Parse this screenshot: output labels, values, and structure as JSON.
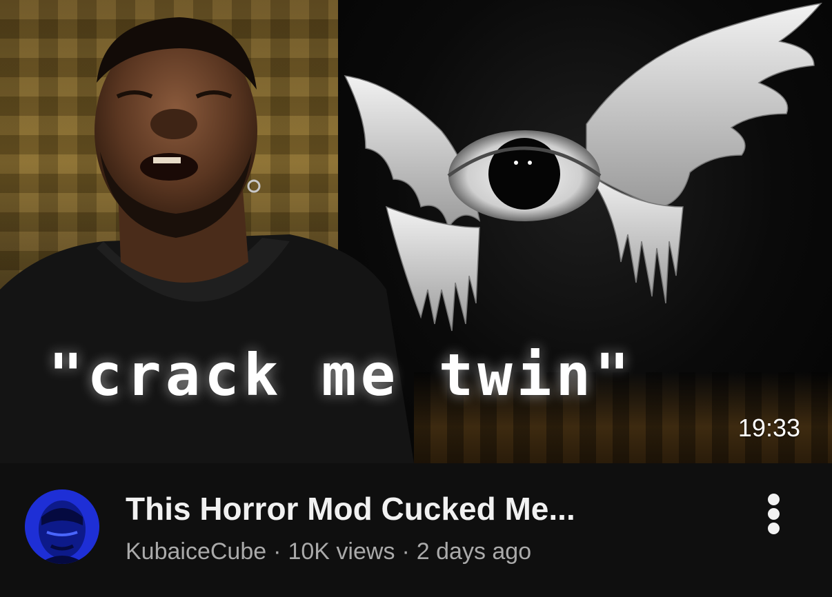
{
  "video": {
    "thumbnail_caption": "\"crack me twin\"",
    "duration": "19:33",
    "title": "This Horror Mod Cucked Me...",
    "channel": "KubaiceCube",
    "separator": "·",
    "views": "10K views",
    "age": "2 days ago"
  },
  "icons": {
    "more": "more-vert-icon",
    "avatar": "channel-avatar"
  },
  "colors": {
    "background": "#0f0f0f",
    "title_text": "#f1f1f1",
    "meta_text": "#aaaaaa",
    "avatar_blue": "#1e2fd6"
  }
}
